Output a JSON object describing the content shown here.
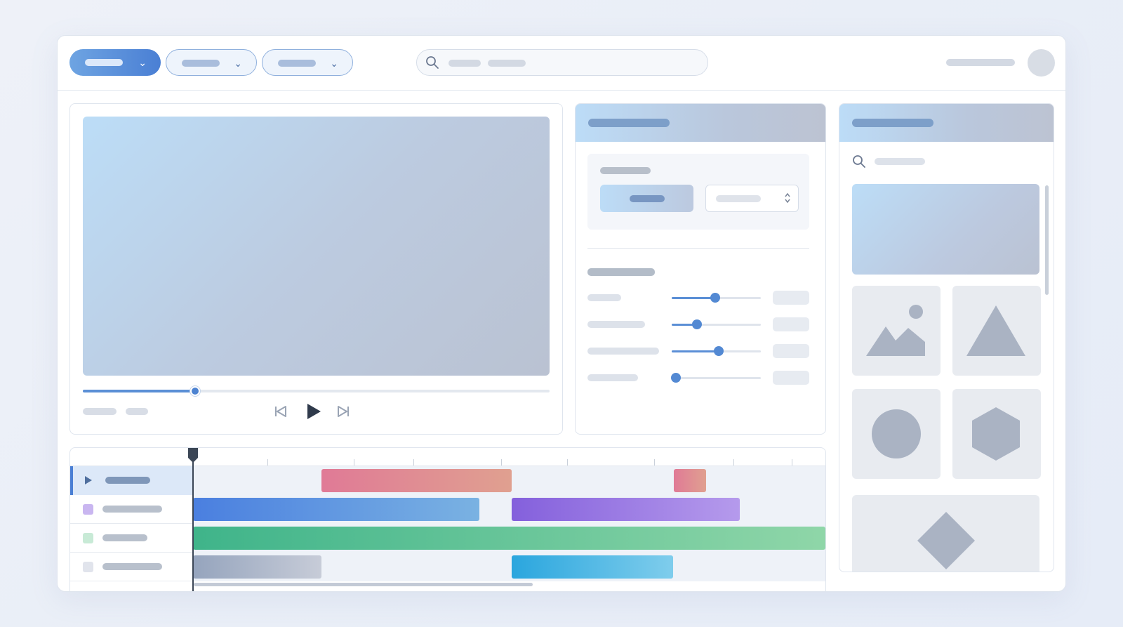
{
  "app": {
    "title": ""
  },
  "toolbar": {
    "menus": [
      {
        "name": "menu-1",
        "variant": "primary",
        "icon": "chevron-down-icon"
      },
      {
        "name": "menu-2",
        "variant": "outline",
        "icon": "chevron-down-icon"
      },
      {
        "name": "menu-3",
        "variant": "outline",
        "icon": "chevron-down-icon"
      }
    ],
    "search": {
      "icon": "search-icon",
      "placeholder": ""
    },
    "user": {
      "avatar": "avatar"
    }
  },
  "preview": {
    "playback_progress": 0.24,
    "controls": [
      "skip-back-icon",
      "play-icon",
      "skip-forward-icon"
    ]
  },
  "properties": {
    "sliders": [
      {
        "value": 0.49
      },
      {
        "value": 0.28
      },
      {
        "value": 0.53
      },
      {
        "value": 0.05
      }
    ]
  },
  "library": {
    "search": {
      "icon": "search-icon"
    },
    "assets": [
      "image-icon",
      "triangle-icon",
      "circle-icon",
      "hexagon-icon",
      "diamond-icon"
    ]
  },
  "timeline": {
    "tracks": [
      {
        "active": true,
        "icon": "play-icon",
        "swatch": "#4a7fd4"
      },
      {
        "active": false,
        "swatch": "#c9b6f0"
      },
      {
        "active": false,
        "swatch": "#c8ead6"
      },
      {
        "active": false,
        "swatch": "#e1e4ec"
      }
    ],
    "colors": {
      "pink": [
        "#e07a96",
        "#e0a090"
      ],
      "blue": [
        "#4a7fe0",
        "#7ab2e2"
      ],
      "purple": [
        "#8460dc",
        "#b59aec"
      ],
      "green": [
        "#3fb48a",
        "#8fd6a8"
      ],
      "gray": [
        "#95a4bd",
        "#c7ccd8"
      ],
      "cyan": [
        "#2aa6de",
        "#7fcdec"
      ]
    }
  },
  "colors": {
    "accent": "#4a7fd4",
    "header_gradient_start": "#bcdcf7",
    "header_gradient_end": "#bcc3d2",
    "playhead": "#3b4656"
  }
}
